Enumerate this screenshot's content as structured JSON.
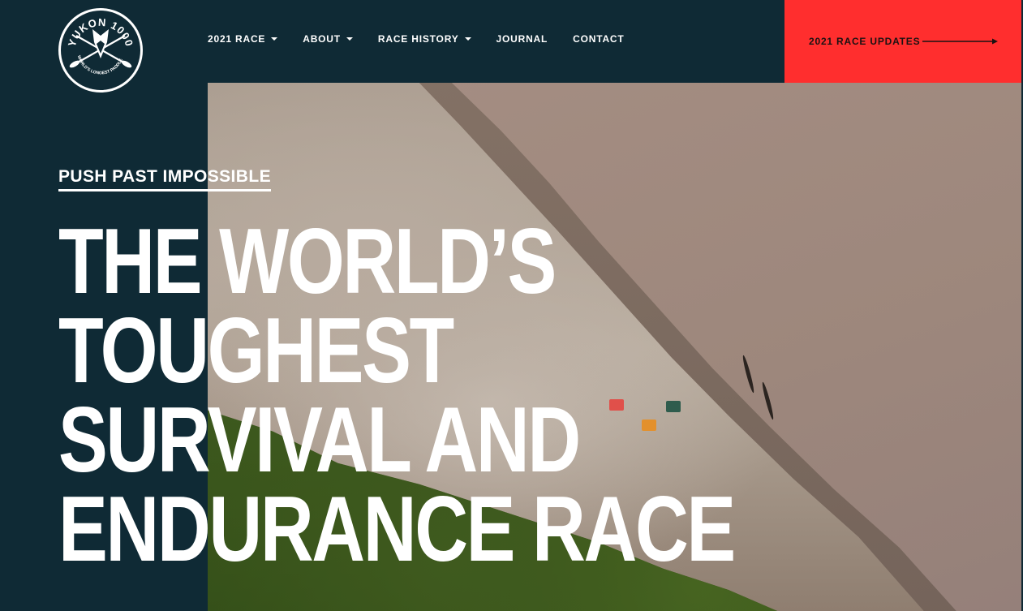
{
  "logo": {
    "name": "YUKON 1000",
    "tagline": "THE WORLD'S LONGEST PADDLE RACE",
    "icon": "wolf-with-crossed-paddles"
  },
  "nav": {
    "items": [
      {
        "label": "2021 RACE",
        "dropdown": true
      },
      {
        "label": "ABOUT",
        "dropdown": true
      },
      {
        "label": "RACE HISTORY",
        "dropdown": true
      },
      {
        "label": "JOURNAL",
        "dropdown": false
      },
      {
        "label": "CONTACT",
        "dropdown": false
      }
    ]
  },
  "cta": {
    "label": "2021 RACE UPDATES",
    "icon": "arrow-right-icon"
  },
  "hero": {
    "eyebrow": "PUSH PAST IMPOSSIBLE",
    "headline_lines": [
      "THE WORLD’S",
      "TOUGHEST",
      "SURVIVAL AND",
      "ENDURANCE RACE"
    ]
  },
  "colors": {
    "background": "#0f2a35",
    "accent": "#ff2e2e",
    "text": "#ffffff"
  }
}
